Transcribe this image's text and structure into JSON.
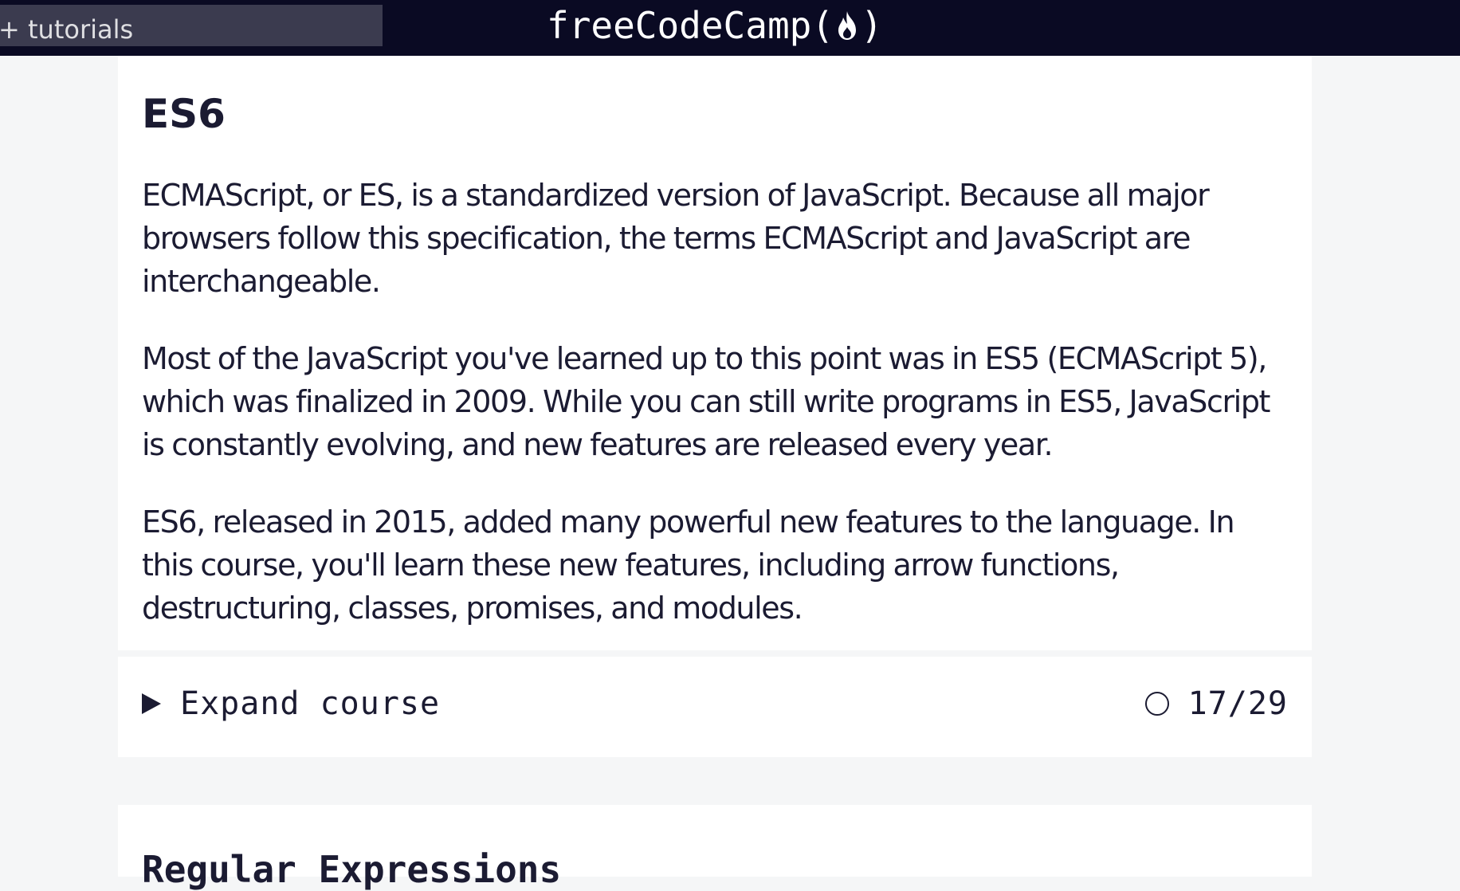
{
  "navbar": {
    "search_text": "+ tutorials",
    "logo_text": "freeCodeCamp",
    "logo_open": "(",
    "logo_close": ")"
  },
  "course": {
    "title": "ES6",
    "paragraphs": [
      "ECMAScript, or ES, is a standardized version of JavaScript. Because all major browsers follow this specification, the terms ECMAScript and JavaScript are interchangeable.",
      "Most of the JavaScript you've learned up to this point was in ES5 (ECMAScript 5), which was finalized in 2009. While you can still write programs in ES5, JavaScript is constantly evolving, and new features are released every year.",
      "ES6, released in 2015, added many powerful new features to the language. In this course, you'll learn these new features, including arrow functions, destructuring, classes, promises, and modules."
    ],
    "expand_label": "Expand course",
    "progress": "17/29"
  },
  "next_course": {
    "title": "Regular Expressions"
  },
  "colors": {
    "navbar_bg": "#0a0a23",
    "search_bg": "#3b3b4f",
    "page_bg": "#f5f6f7",
    "text": "#1b1b32"
  }
}
